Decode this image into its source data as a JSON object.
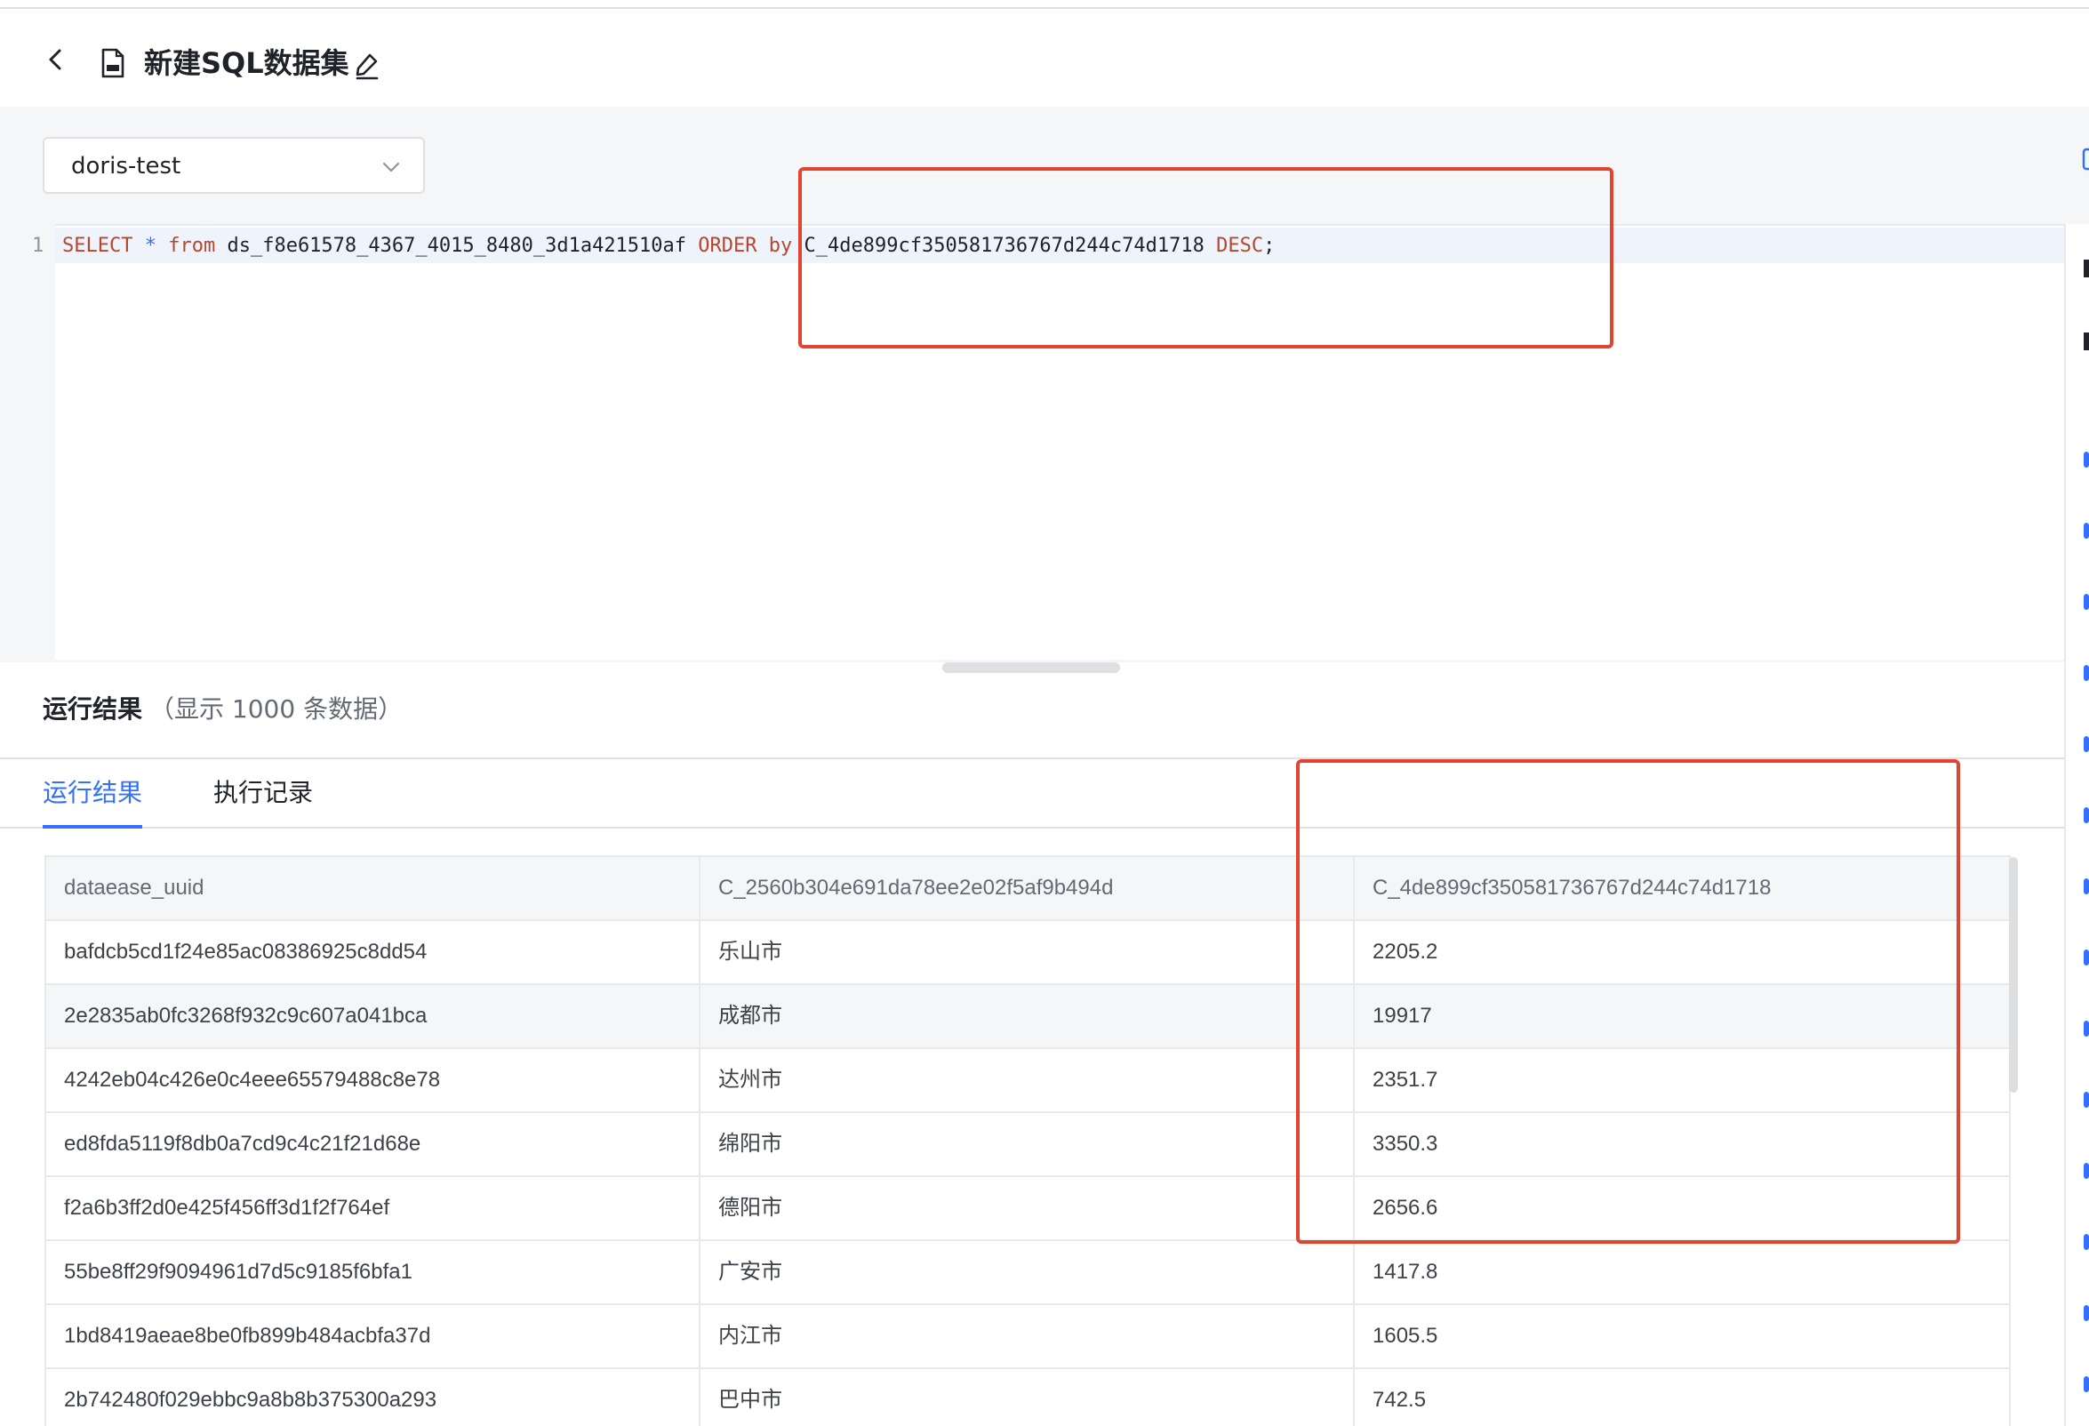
{
  "header": {
    "title": "新建SQL数据集"
  },
  "datasource": {
    "selected": "doris-test"
  },
  "editor": {
    "line_number": "1",
    "tokens": {
      "select": "SELECT",
      "star": "*",
      "from": "from",
      "table": "ds_f8e61578_4367_4015_8480_3d1a421510af",
      "order_by": "ORDER by",
      "column": "C_4de899cf350581736767d244c74d1718",
      "desc": "DESC",
      "semicolon": ";"
    }
  },
  "result": {
    "title": "运行结果",
    "count_note": "（显示 1000 条数据）",
    "tabs": [
      {
        "label": "运行结果"
      },
      {
        "label": "执行记录"
      }
    ]
  },
  "table": {
    "columns": [
      "dataease_uuid",
      "C_2560b304e691da78ee2e02f5af9b494d",
      "C_4de899cf350581736767d244c74d1718"
    ],
    "rows": [
      [
        "bafdcb5cd1f24e85ac08386925c8dd54",
        "乐山市",
        "2205.2"
      ],
      [
        "2e2835ab0fc3268f932c9c607a041bca",
        "成都市",
        "19917"
      ],
      [
        "4242eb04c426e0c4eee65579488c8e78",
        "达州市",
        "2351.7"
      ],
      [
        "ed8fda5119f8db0a7cd9c4c21f21d68e",
        "绵阳市",
        "3350.3"
      ],
      [
        "f2a6b3ff2d0e425f456ff3d1f2f764ef",
        "德阳市",
        "2656.6"
      ],
      [
        "55be8ff29f9094961d7d5c9185f6bfa1",
        "广安市",
        "1417.8"
      ],
      [
        "1bd8419aeae8be0fb899b484acbfa37d",
        "内江市",
        "1605.5"
      ],
      [
        "2b742480f029ebbc9a8b8b375300a293",
        "巴中市",
        "742.5"
      ]
    ]
  },
  "colors": {
    "accent": "#3370ff",
    "annotation": "#e2452f",
    "keyword": "#b7472a"
  }
}
